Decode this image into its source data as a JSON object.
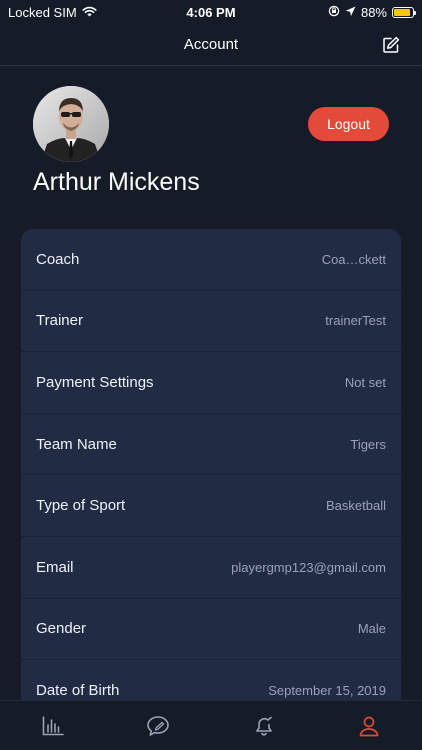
{
  "status_bar": {
    "carrier": "Locked SIM",
    "time": "4:06 PM",
    "battery_percent": "88%",
    "battery_level": 0.88,
    "battery_color": "#f5c518"
  },
  "nav": {
    "title": "Account",
    "edit_icon": "edit-icon"
  },
  "profile": {
    "name": "Arthur Mickens",
    "logout_label": "Logout"
  },
  "details": [
    {
      "label": "Coach",
      "value": "Coa…ckett"
    },
    {
      "label": "Trainer",
      "value": "trainerTest"
    },
    {
      "label": "Payment Settings",
      "value": "Not set"
    },
    {
      "label": "Team Name",
      "value": "Tigers"
    },
    {
      "label": "Type of Sport",
      "value": "Basketball"
    },
    {
      "label": "Email",
      "value": "playergmp123@gmail.com"
    },
    {
      "label": "Gender",
      "value": "Male"
    },
    {
      "label": "Date of Birth",
      "value": "September 15, 2019"
    }
  ],
  "tabs": [
    {
      "icon": "stats-icon",
      "active": false
    },
    {
      "icon": "chat-icon",
      "active": false
    },
    {
      "icon": "bell-icon",
      "active": false
    },
    {
      "icon": "profile-icon",
      "active": true
    }
  ],
  "colors": {
    "background": "#151b27",
    "card": "#212b44",
    "accent": "#e34a3a",
    "inactive_icon": "#9aa2b6"
  }
}
